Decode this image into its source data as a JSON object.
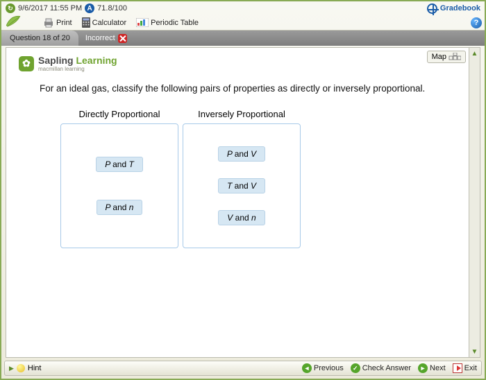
{
  "header": {
    "datetime": "9/6/2017 11:55 PM",
    "score": "71.8/100",
    "gradebook": "Gradebook"
  },
  "toolbar": {
    "print": "Print",
    "calculator": "Calculator",
    "periodic": "Periodic Table"
  },
  "tabs": {
    "question": "Question 18 of 20",
    "status": "Incorrect"
  },
  "content": {
    "map_button": "Map",
    "brand1": "Sapling",
    "brand2": "Learning",
    "brand_sub": "macmillan learning",
    "question": "For an ideal gas, classify the following pairs of properties as directly or inversely proportional.",
    "zone_left_title": "Directly Proportional",
    "zone_right_title": "Inversely Proportional",
    "chips_left": [
      {
        "a": "P",
        "b": "T"
      },
      {
        "a": "P",
        "b": "n"
      }
    ],
    "chips_right": [
      {
        "a": "P",
        "b": "V"
      },
      {
        "a": "T",
        "b": "V"
      },
      {
        "a": "V",
        "b": "n"
      }
    ],
    "chip_and": "and"
  },
  "footer": {
    "hint": "Hint",
    "previous": "Previous",
    "check": "Check Answer",
    "next": "Next",
    "exit": "Exit"
  }
}
